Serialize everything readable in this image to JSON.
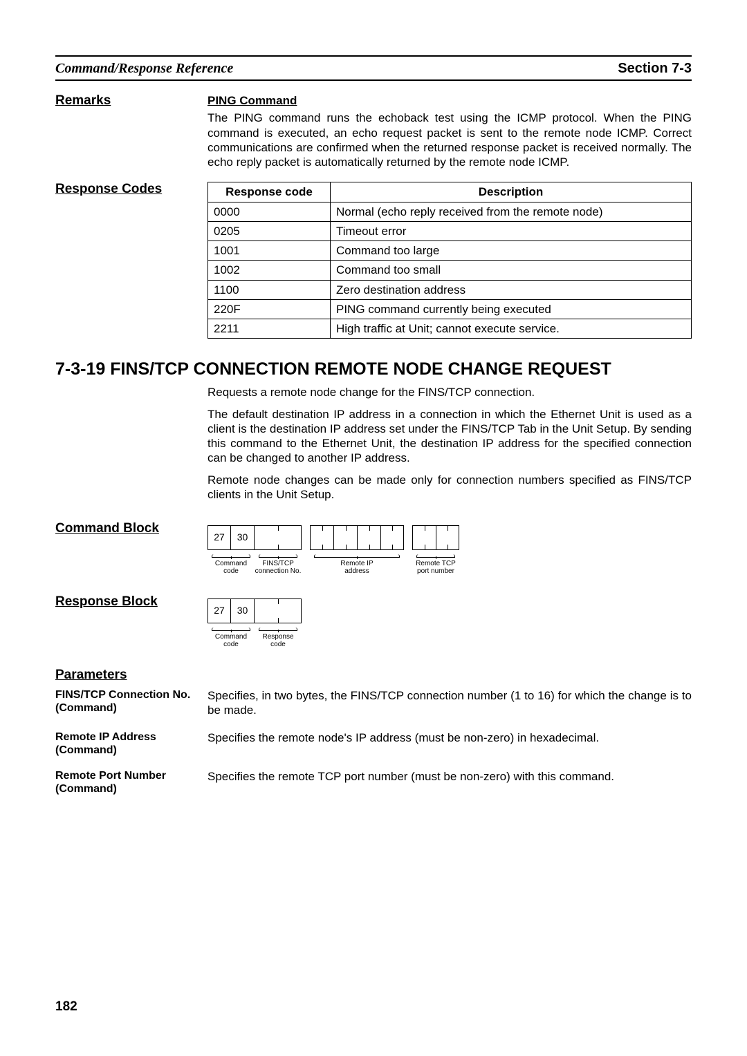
{
  "header": {
    "left": "Command/Response Reference",
    "right": "Section 7-3"
  },
  "remarks": {
    "heading": "Remarks",
    "sub": "PING Command",
    "text": "The PING command runs the echoback test using the ICMP protocol. When the PING command is executed, an echo request packet is sent to the remote node ICMP. Correct communications are confirmed when the returned response packet is received normally. The echo reply packet is automatically returned by the remote node ICMP."
  },
  "resp_codes": {
    "heading": "Response Codes",
    "th_code": "Response code",
    "th_desc": "Description",
    "rows": [
      {
        "code": "0000",
        "desc": "Normal (echo reply received from the remote node)"
      },
      {
        "code": "0205",
        "desc": "Timeout error"
      },
      {
        "code": "1001",
        "desc": "Command too large"
      },
      {
        "code": "1002",
        "desc": "Command too small"
      },
      {
        "code": "1100",
        "desc": "Zero destination address"
      },
      {
        "code": "220F",
        "desc": "PING command currently being executed"
      },
      {
        "code": "2211",
        "desc": "High traffic at Unit; cannot execute service."
      }
    ]
  },
  "section": {
    "title": "7-3-19  FINS/TCP CONNECTION REMOTE NODE CHANGE REQUEST",
    "p1": "Requests a remote node change for the FINS/TCP connection.",
    "p2": "The default destination IP address in a connection in which the Ethernet Unit is used as a client is the destination IP address set under the FINS/TCP Tab in the Unit Setup. By sending this command to the Ethernet Unit, the destination IP address for the specified connection can be changed to another IP address.",
    "p3": "Remote node changes can be made only for connection numbers specified as FINS/TCP clients in the Unit Setup."
  },
  "cmd_block": {
    "heading": "Command Block",
    "b1": "27",
    "b2": "30",
    "l1a": "Command",
    "l1b": "code",
    "l2a": "FINS/TCP",
    "l2b": "connection No.",
    "l3a": "Remote IP",
    "l3b": "address",
    "l4a": "Remote TCP",
    "l4b": "port number"
  },
  "resp_block": {
    "heading": "Response Block",
    "b1": "27",
    "b2": "30",
    "l1a": "Command",
    "l1b": "code",
    "l2a": "Response",
    "l2b": "code"
  },
  "params": {
    "heading": "Parameters",
    "items": [
      {
        "label": "FINS/TCP Connection No. (Command)",
        "desc": "Specifies, in two bytes, the FINS/TCP connection number (1 to 16) for which the change is to be made."
      },
      {
        "label": "Remote IP Address (Command)",
        "desc": "Specifies the remote node's IP address (must be non-zero) in hexadecimal."
      },
      {
        "label": "Remote Port Number (Command)",
        "desc": "Specifies the remote TCP port number (must be non-zero) with this command."
      }
    ]
  },
  "pagenum": "182"
}
